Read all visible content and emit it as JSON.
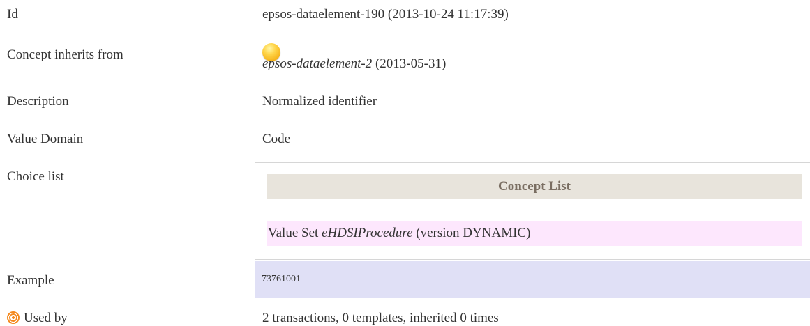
{
  "rows": {
    "id": {
      "label": "Id",
      "value": "epsos-dataelement-190 (2013-10-24 11:17:39)"
    },
    "inherits": {
      "label": "Concept inherits from",
      "link": "epsos-dataelement-2",
      "suffix": " (2013-05-31)",
      "icon": "yellow-orb-icon"
    },
    "description": {
      "label": "Description",
      "value": "Normalized identifier"
    },
    "value_domain": {
      "label": "Value Domain",
      "value": "Code"
    },
    "choice_list": {
      "label": "Choice list",
      "header": "Concept List",
      "value_set_prefix": "Value Set ",
      "value_set_name": "eHDSIProcedure",
      "value_set_suffix": " (version DYNAMIC)"
    },
    "example": {
      "label": "Example",
      "value": "73761001"
    },
    "used_by": {
      "label": "Used by",
      "value": "2 transactions, 0 templates, inherited 0 times",
      "icon": "target-icon"
    }
  },
  "colors": {
    "header_bg": "#e8e4dc",
    "header_text": "#7a6e62",
    "valueset_bg": "#fde7fd",
    "example_bg": "#e0e0f6",
    "icon_orange": "#f48a1f",
    "orb_yellow": "#ffd54a"
  }
}
